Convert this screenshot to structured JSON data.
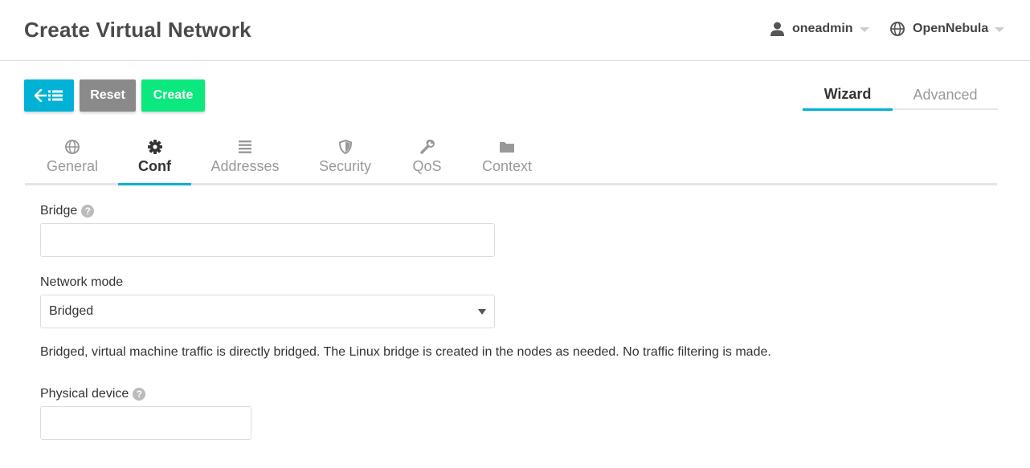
{
  "header": {
    "title": "Create Virtual Network",
    "user": "oneadmin",
    "zone": "OpenNebula"
  },
  "toolbar": {
    "reset_label": "Reset",
    "create_label": "Create"
  },
  "mode_tabs": {
    "wizard": "Wizard",
    "advanced": "Advanced",
    "active": "Wizard"
  },
  "tabs": [
    {
      "label": "General",
      "icon": "globe-icon"
    },
    {
      "label": "Conf",
      "icon": "gear-icon"
    },
    {
      "label": "Addresses",
      "icon": "list-icon"
    },
    {
      "label": "Security",
      "icon": "shield-icon"
    },
    {
      "label": "QoS",
      "icon": "wrench-icon"
    },
    {
      "label": "Context",
      "icon": "folder-icon"
    }
  ],
  "active_tab": "Conf",
  "form": {
    "bridge": {
      "label": "Bridge",
      "value": ""
    },
    "network_mode": {
      "label": "Network mode",
      "value": "Bridged"
    },
    "mode_description": "Bridged, virtual machine traffic is directly bridged. The Linux bridge is created in the nodes as needed. No traffic filtering is made.",
    "physical_device": {
      "label": "Physical device",
      "value": ""
    }
  },
  "colors": {
    "accent": "#00b2d5",
    "create": "#0be87d",
    "reset": "#8a8a8a"
  }
}
